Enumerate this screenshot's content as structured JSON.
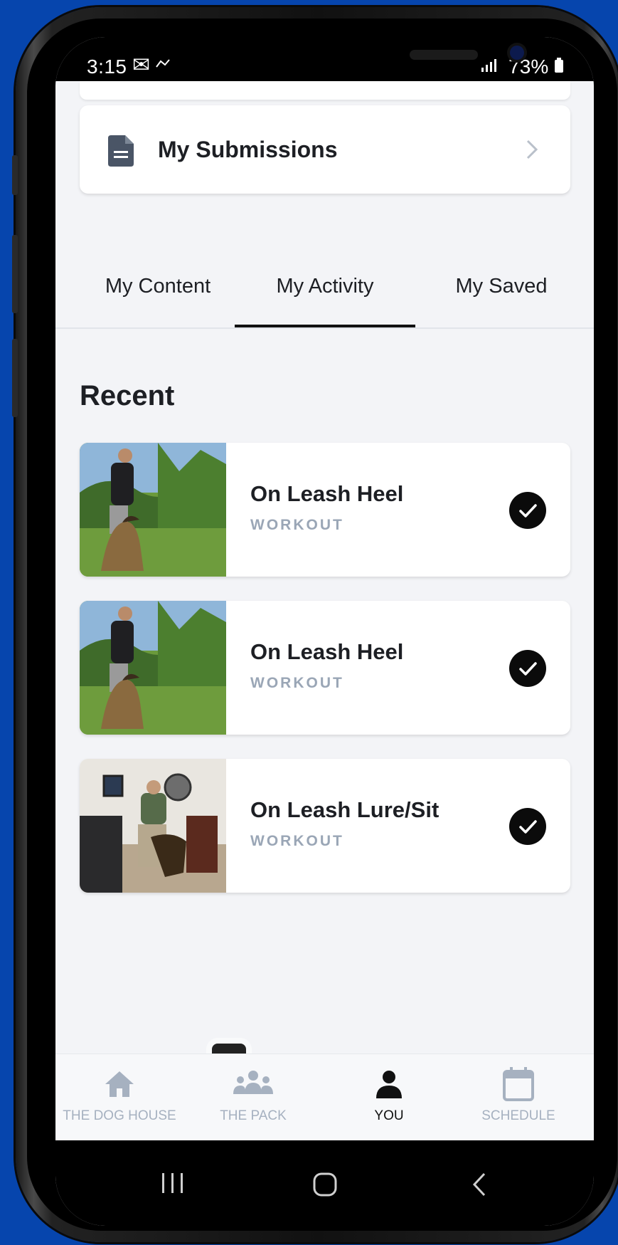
{
  "status": {
    "time": "3:15",
    "battery": "73%"
  },
  "profile": {
    "submissions_label": "My Submissions"
  },
  "tabs": [
    "My Content",
    "My Activity",
    "My Saved"
  ],
  "active_tab": "My Activity",
  "recent": {
    "title": "Recent",
    "items": [
      {
        "title": "On Leash Heel",
        "type": "WORKOUT",
        "completed": true
      },
      {
        "title": "On Leash Heel",
        "type": "WORKOUT",
        "completed": true
      },
      {
        "title": "On Leash Lure/Sit",
        "type": "WORKOUT",
        "completed": true
      }
    ]
  },
  "nav": {
    "items": [
      {
        "label": "THE DOG HOUSE",
        "icon": "home-icon",
        "active": false
      },
      {
        "label": "THE PACK",
        "icon": "group-icon",
        "active": false
      },
      {
        "label": "YOU",
        "icon": "person-icon",
        "active": true
      },
      {
        "label": "SCHEDULE",
        "icon": "calendar-icon",
        "active": false
      }
    ]
  },
  "colors": {
    "background": "#0645ad",
    "muted": "#a6b1c0",
    "accent": "#111111"
  }
}
